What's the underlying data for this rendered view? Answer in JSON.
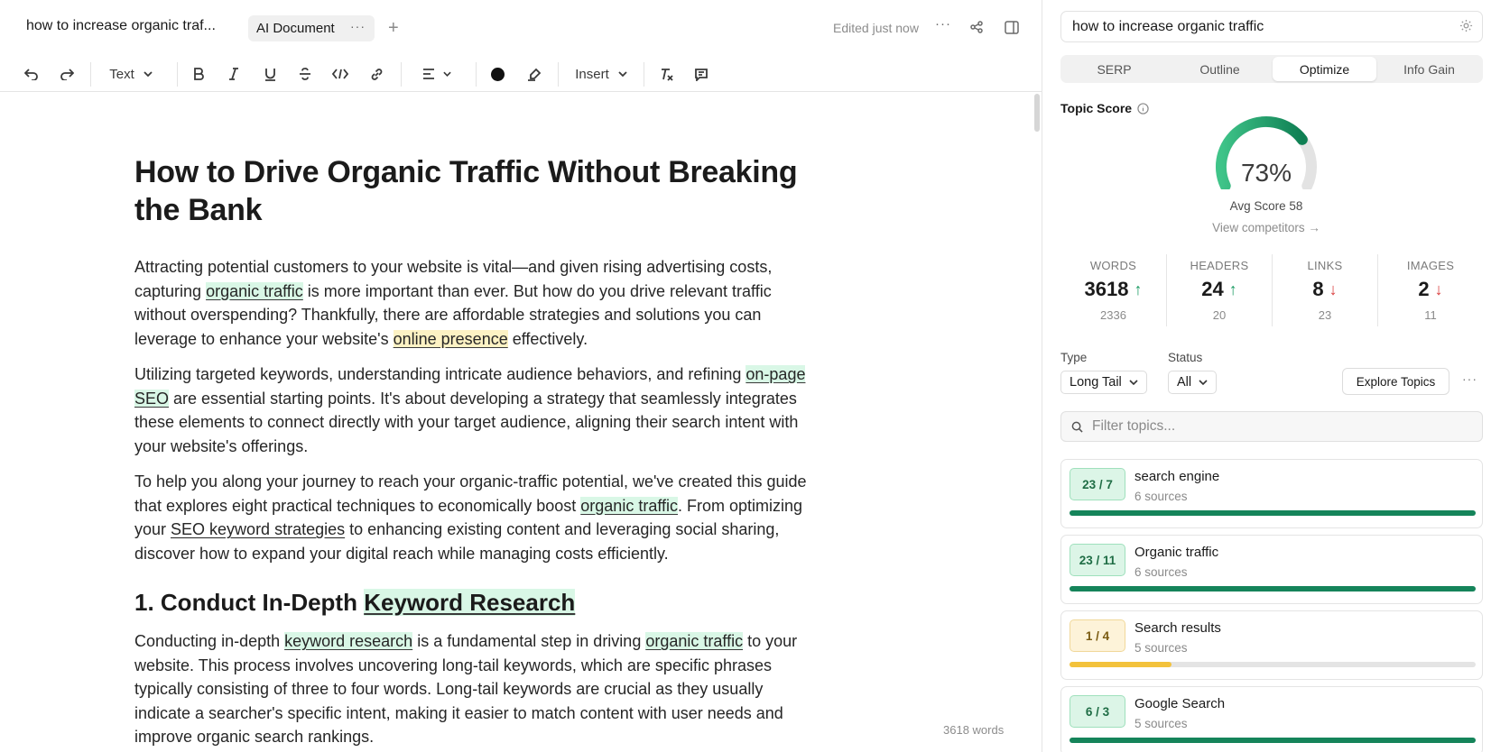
{
  "header": {
    "doc_title": "how to increase organic traf...",
    "tab_label": "AI Document",
    "tab_menu": "···",
    "add_tab": "+",
    "edited_status": "Edited just now",
    "more": "···"
  },
  "toolbar": {
    "text_style": "Text",
    "insert": "Insert"
  },
  "document": {
    "title": "How to Drive Organic Traffic Without Breaking the Bank",
    "p1_a": "Attracting potential customers to your website is vital—and given rising advertising costs, capturing ",
    "p1_hl1": "organic traffic",
    "p1_b": " is more important than ever. But how do you drive relevant traffic without overspending? Thankfully, there are affordable strategies and solutions you can leverage to enhance your website's ",
    "p1_hl2": "online presence",
    "p1_c": " effectively.",
    "p2_a": "Utilizing targeted keywords, understanding intricate audience behaviors, and refining ",
    "p2_hl1": "on-page SEO",
    "p2_b": " are essential starting points. It's about developing a strategy that seamlessly integrates these elements to connect directly with your target audience, aligning their search intent with your website's offerings.",
    "p3_a": "To help you along your journey to reach your organic-traffic potential, we've created this guide that explores eight practical techniques to economically boost ",
    "p3_hl1": "organic traffic",
    "p3_b": ". From optimizing your ",
    "p3_link": "SEO keyword strategies",
    "p3_c": " to enhancing existing content and leveraging social sharing, discover how to expand your digital reach while managing costs efficiently.",
    "h2_a": "1. Conduct In-Depth ",
    "h2_hl": "Keyword Research",
    "p4_a": "Conducting in-depth ",
    "p4_hl1": "keyword research",
    "p4_b": " is a fundamental step in driving ",
    "p4_hl2": "organic traffic",
    "p4_c": " to your website. This process involves uncovering long-tail keywords, which are specific phrases typically consisting of three to four words. Long-tail keywords are crucial as they usually indicate a searcher's specific intent, making it easier to match content with user needs and improve organic search rankings.",
    "word_count": "3618 words"
  },
  "sidebar": {
    "query": "how to increase organic traffic",
    "tabs": [
      {
        "label": "SERP"
      },
      {
        "label": "Outline"
      },
      {
        "label": "Optimize"
      },
      {
        "label": "Info Gain"
      }
    ],
    "active_tab": "Optimize",
    "topic_score_label": "Topic Score",
    "topic_score": 0.73,
    "topic_score_text": "73%",
    "avg_score": "Avg Score 58",
    "view_competitors": "View competitors →",
    "stats": [
      {
        "label": "WORDS",
        "value": "3618",
        "trend": "up",
        "sub": "2336"
      },
      {
        "label": "HEADERS",
        "value": "24",
        "trend": "up",
        "sub": "20"
      },
      {
        "label": "LINKS",
        "value": "8",
        "trend": "down",
        "sub": "23"
      },
      {
        "label": "IMAGES",
        "value": "2",
        "trend": "down",
        "sub": "11"
      }
    ],
    "type_label": "Type",
    "type_value": "Long Tail",
    "status_label": "Status",
    "status_value": "All",
    "explore_button": "Explore Topics",
    "filter_placeholder": "Filter topics...",
    "topics": [
      {
        "badge": "23 / 7",
        "name": "search engine",
        "sources": "6 sources",
        "progress": 1.0,
        "tone": "green"
      },
      {
        "badge": "23 / 11",
        "name": "Organic traffic",
        "sources": "6 sources",
        "progress": 1.0,
        "tone": "green"
      },
      {
        "badge": "1 / 4",
        "name": "Search results",
        "sources": "5 sources",
        "progress": 0.25,
        "tone": "yellow"
      },
      {
        "badge": "6 / 3",
        "name": "Google Search",
        "sources": "5 sources",
        "progress": 1.0,
        "tone": "green"
      }
    ],
    "colors": {
      "accent_green": "#15845a",
      "gauge_green": "#2bb17a",
      "progress_yellow": "#f3c23b",
      "up": "#1a9b63",
      "down": "#d93b3b"
    }
  }
}
